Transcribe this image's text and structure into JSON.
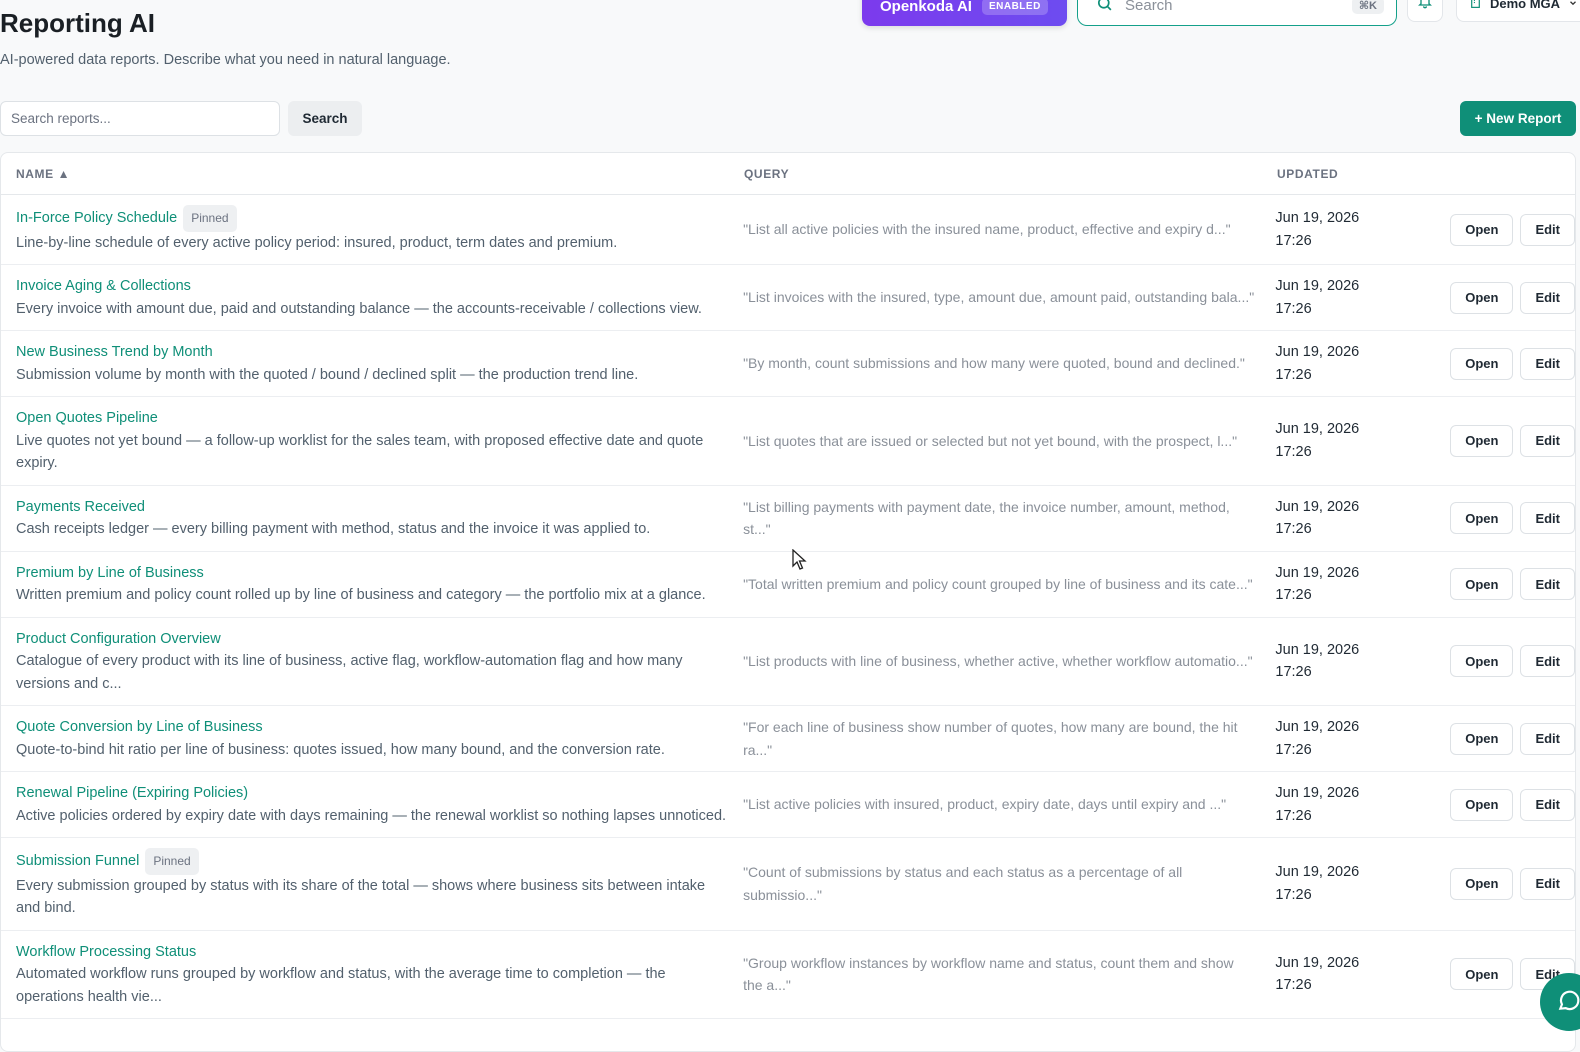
{
  "topbar": {
    "ai_name": "Openkoda AI",
    "ai_badge": "ENABLED",
    "search_placeholder": "Search",
    "search_shortcut": "⌘K",
    "tenant_name": "Demo MGA"
  },
  "header": {
    "title": "Reporting AI",
    "subtitle": "AI-powered data reports. Describe what you need in natural language."
  },
  "toolbar": {
    "search_placeholder": "Search reports...",
    "search_label": "Search",
    "new_report_label": "+ New Report"
  },
  "table": {
    "columns": {
      "name": "NAME ▲",
      "query": "QUERY",
      "updated": "UPDATED"
    },
    "open_label": "Open",
    "edit_label": "Edit",
    "pinned_label": "Pinned",
    "rows": [
      {
        "name": "In-Force Policy Schedule",
        "pinned": true,
        "desc": "Line-by-line schedule of every active policy period: insured, product, term dates and premium.",
        "query": "\"List all active policies with the insured name, product, effective and expiry d...\"",
        "date": "Jun 19, 2026",
        "time": "17:26"
      },
      {
        "name": "Invoice Aging & Collections",
        "pinned": false,
        "desc": "Every invoice with amount due, paid and outstanding balance — the accounts-receivable / collections view.",
        "query": "\"List invoices with the insured, type, amount due, amount paid, outstanding bala...\"",
        "date": "Jun 19, 2026",
        "time": "17:26"
      },
      {
        "name": "New Business Trend by Month",
        "pinned": false,
        "desc": "Submission volume by month with the quoted / bound / declined split — the production trend line.",
        "query": "\"By month, count submissions and how many were quoted, bound and declined.\"",
        "date": "Jun 19, 2026",
        "time": "17:26"
      },
      {
        "name": "Open Quotes Pipeline",
        "pinned": false,
        "desc": "Live quotes not yet bound — a follow-up worklist for the sales team, with proposed effective date and quote expiry.",
        "query": "\"List quotes that are issued or selected but not yet bound, with the prospect, l...\"",
        "date": "Jun 19, 2026",
        "time": "17:26"
      },
      {
        "name": "Payments Received",
        "pinned": false,
        "desc": "Cash receipts ledger — every billing payment with method, status and the invoice it was applied to.",
        "query": "\"List billing payments with payment date, the invoice number, amount, method, st...\"",
        "date": "Jun 19, 2026",
        "time": "17:26"
      },
      {
        "name": "Premium by Line of Business",
        "pinned": false,
        "desc": "Written premium and policy count rolled up by line of business and category — the portfolio mix at a glance.",
        "query": "\"Total written premium and policy count grouped by line of business and its cate...\"",
        "date": "Jun 19, 2026",
        "time": "17:26"
      },
      {
        "name": "Product Configuration Overview",
        "pinned": false,
        "desc": "Catalogue of every product with its line of business, active flag, workflow-automation flag and how many versions and c...",
        "query": "\"List products with line of business, whether active, whether workflow automatio...\"",
        "date": "Jun 19, 2026",
        "time": "17:26"
      },
      {
        "name": "Quote Conversion by Line of Business",
        "pinned": false,
        "desc": "Quote-to-bind hit ratio per line of business: quotes issued, how many bound, and the conversion rate.",
        "query": "\"For each line of business show number of quotes, how many are bound, the hit ra...\"",
        "date": "Jun 19, 2026",
        "time": "17:26"
      },
      {
        "name": "Renewal Pipeline (Expiring Policies)",
        "pinned": false,
        "desc": "Active policies ordered by expiry date with days remaining — the renewal worklist so nothing lapses unnoticed.",
        "query": "\"List active policies with insured, product, expiry date, days until expiry and ...\"",
        "date": "Jun 19, 2026",
        "time": "17:26"
      },
      {
        "name": "Submission Funnel",
        "pinned": true,
        "desc": "Every submission grouped by status with its share of the total — shows where business sits between intake and bind.",
        "query": "\"Count of submissions by status and each status as a percentage of all submissio...\"",
        "date": "Jun 19, 2026",
        "time": "17:26"
      },
      {
        "name": "Workflow Processing Status",
        "pinned": false,
        "desc": "Automated workflow runs grouped by workflow and status, with the average time to completion — the operations health vie...",
        "query": "\"Group workflow instances by workflow name and status, count them and show the a...\"",
        "date": "Jun 19, 2026",
        "time": "17:26"
      }
    ]
  },
  "colors": {
    "accent": "#0f8f78",
    "ai_purple": "#7c3aed"
  }
}
